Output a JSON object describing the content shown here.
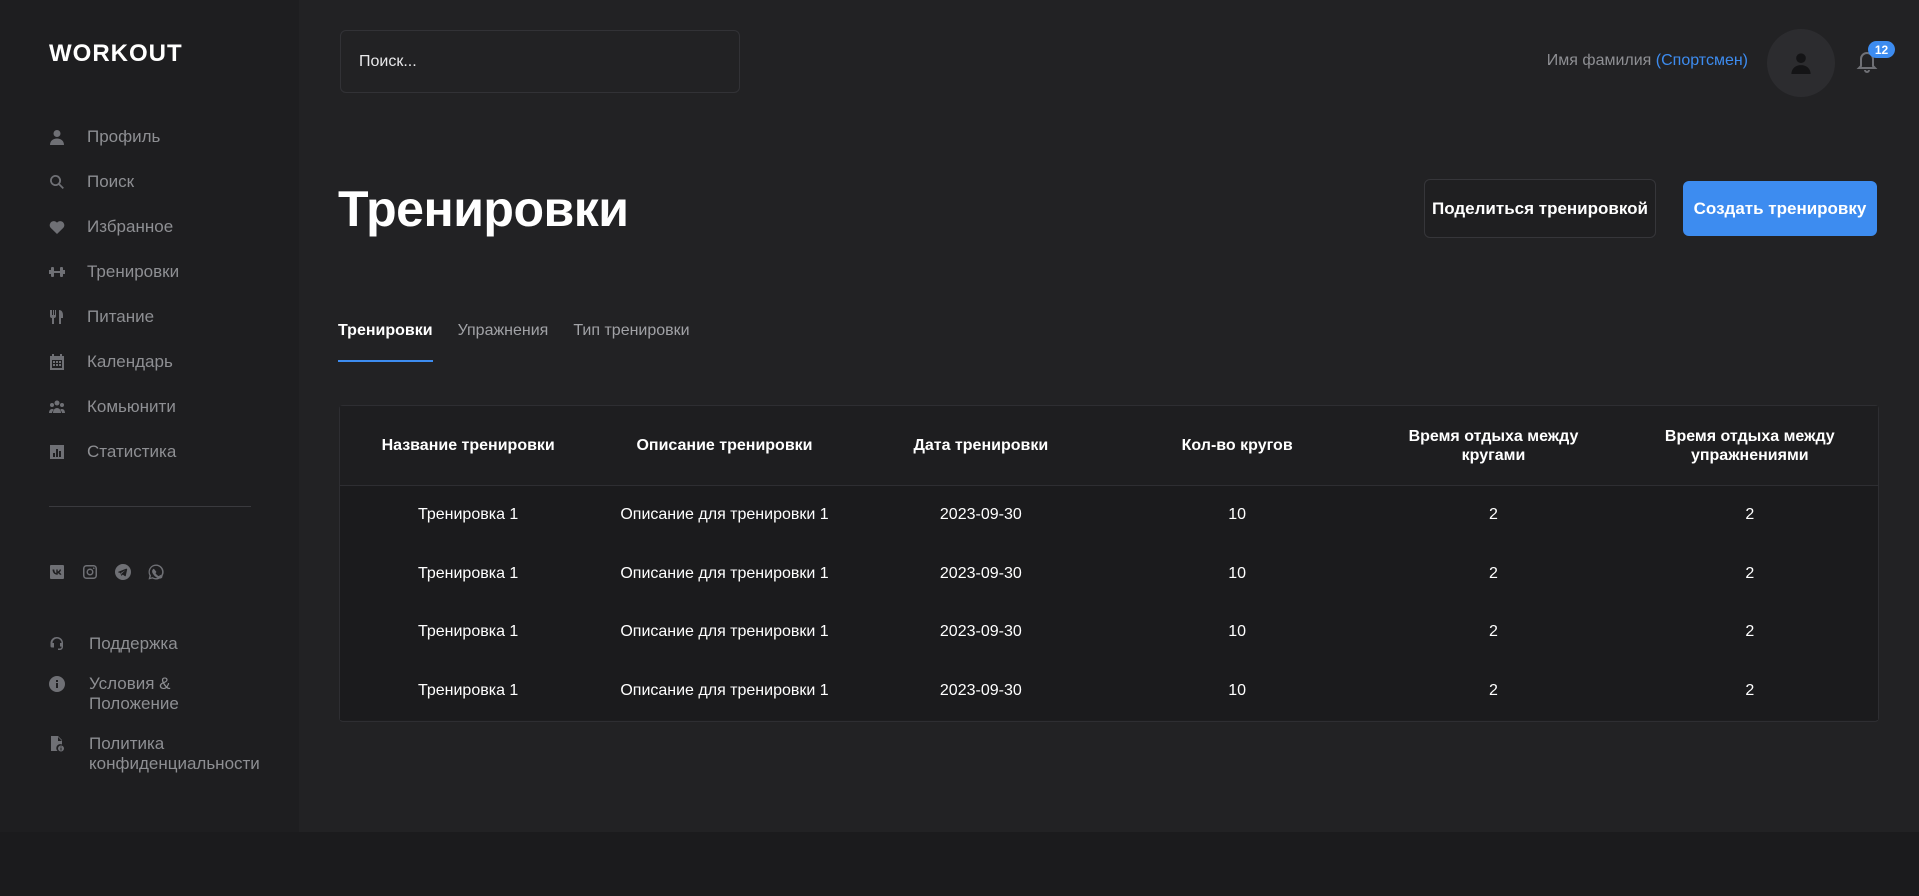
{
  "sidebar": {
    "logo": "WORKOUT",
    "items": [
      {
        "label": "Профиль",
        "icon": "user-icon"
      },
      {
        "label": "Поиск",
        "icon": "search-icon"
      },
      {
        "label": "Избранное",
        "icon": "heart-icon"
      },
      {
        "label": "Тренировки",
        "icon": "dumbbell-icon"
      },
      {
        "label": "Питание",
        "icon": "utensils-icon"
      },
      {
        "label": "Календарь",
        "icon": "calendar-icon"
      },
      {
        "label": "Комьюнити",
        "icon": "users-icon"
      },
      {
        "label": "Статистика",
        "icon": "chart-icon"
      }
    ],
    "socials": [
      "vk-icon",
      "instagram-icon",
      "telegram-icon",
      "whatsapp-icon"
    ],
    "bottom": [
      {
        "label": "Поддержка",
        "icon": "headset-icon"
      },
      {
        "label": "Условия & Положение",
        "icon": "info-icon"
      },
      {
        "label": "Политика конфиденциальности",
        "icon": "document-icon"
      }
    ]
  },
  "header": {
    "search_placeholder": "Поиск...",
    "user_name": "Имя фамилия",
    "user_role": "(Спортсмен)",
    "notifications_count": "12"
  },
  "page": {
    "title": "Тренировки",
    "share_button": "Поделиться тренировкой",
    "create_button": "Создать тренировку",
    "tabs": [
      "Тренировки",
      "Упражнения",
      "Тип тренировки"
    ],
    "active_tab": 0
  },
  "table": {
    "columns": [
      "Название тренировки",
      "Описание тренировки",
      "Дата тренировки",
      "Кол-во кругов",
      "Время отдыха между кругами",
      "Время отдыха между упражнениями"
    ],
    "rows": [
      [
        "Тренировка 1",
        "Описание для тренировки 1",
        "2023-09-30",
        "10",
        "2",
        "2"
      ],
      [
        "Тренировка 1",
        "Описание для тренировки 1",
        "2023-09-30",
        "10",
        "2",
        "2"
      ],
      [
        "Тренировка 1",
        "Описание для тренировки 1",
        "2023-09-30",
        "10",
        "2",
        "2"
      ],
      [
        "Тренировка 1",
        "Описание для тренировки 1",
        "2023-09-30",
        "10",
        "2",
        "2"
      ]
    ]
  },
  "colors": {
    "accent": "#3d8cf0",
    "background": "#222224",
    "sidebar": "#1e1e20"
  }
}
